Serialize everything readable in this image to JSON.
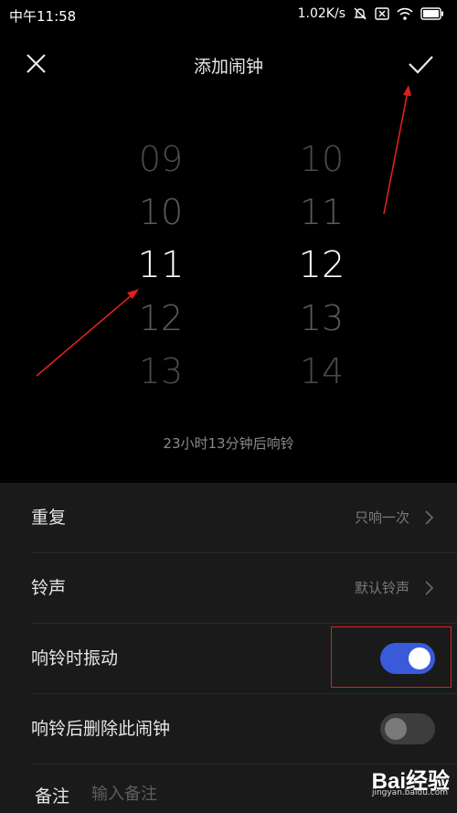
{
  "status_bar": {
    "time": "中午11:58",
    "network_speed": "1.02K/s"
  },
  "header": {
    "title": "添加闹钟"
  },
  "hour_picker": {
    "values": [
      "09",
      "10",
      "11",
      "12",
      "13"
    ],
    "selected": "11"
  },
  "minute_picker": {
    "values": [
      "10",
      "11",
      "12",
      "13",
      "14"
    ],
    "selected": "12"
  },
  "countdown": "23小时13分钟后响铃",
  "settings": {
    "repeat": {
      "label": "重复",
      "value": "只响一次"
    },
    "ringtone": {
      "label": "铃声",
      "value": "默认铃声"
    },
    "vibrate": {
      "label": "响铃时振动",
      "enabled": true
    },
    "delete_after": {
      "label": "响铃后删除此闹钟",
      "enabled": false
    }
  },
  "note": {
    "label": "备注",
    "placeholder": "输入备注"
  },
  "watermark": {
    "logo": "Bai经验",
    "url": "jingyan.baidu.com"
  },
  "colors": {
    "toggle_on": "#3a5bd9",
    "highlight_box": "#e0201c",
    "arrow": "#e0201c"
  }
}
